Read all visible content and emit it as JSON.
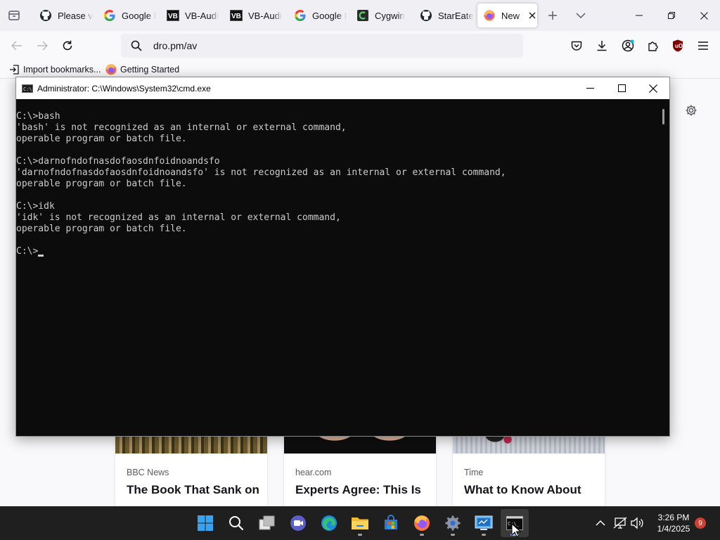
{
  "browser": {
    "tabs": [
      {
        "label": "Please v",
        "icon": "github-icon"
      },
      {
        "label": "Google I",
        "icon": "google-icon"
      },
      {
        "label": "VB-Audi",
        "icon": "vb-audio-icon"
      },
      {
        "label": "VB-Audi",
        "icon": "vb-audio-icon"
      },
      {
        "label": "Google I",
        "icon": "google-icon"
      },
      {
        "label": "Cygwin",
        "icon": "cygwin-icon"
      },
      {
        "label": "StarEate",
        "icon": "github-icon"
      },
      {
        "label": "New T",
        "icon": "firefox-icon",
        "active": true
      }
    ],
    "url": "dro.pm/av",
    "bookmarks": [
      {
        "label": "Import bookmarks...",
        "icon": "import-icon"
      },
      {
        "label": "Getting Started",
        "icon": "firefox-icon"
      }
    ],
    "cards": [
      {
        "source": "BBC News",
        "headline": "The Book That Sank on"
      },
      {
        "source": "hear.com",
        "headline": "Experts Agree: This Is"
      },
      {
        "source": "Time",
        "headline": "What to Know About"
      }
    ]
  },
  "cmd": {
    "title": "Administrator: C:\\Windows\\System32\\cmd.exe",
    "lines": [
      "C:\\>bash",
      "'bash' is not recognized as an internal or external command,",
      "operable program or batch file.",
      "",
      "C:\\>darnofndofnasdofaosdnfoidnoandsfo",
      "'darnofndofnasdofaosdnfoidnoandsfo' is not recognized as an internal or external command,",
      "operable program or batch file.",
      "",
      "C:\\>idk",
      "'idk' is not recognized as an internal or external command,",
      "operable program or batch file.",
      "",
      "C:\\>"
    ]
  },
  "taskbar": {
    "apps": [
      "start-icon",
      "search-icon",
      "task-view-icon",
      "teams-icon",
      "edge-icon",
      "file-explorer-icon",
      "store-icon",
      "firefox-icon",
      "settings-icon",
      "control-panel-icon",
      "cmd-icon"
    ],
    "time": "3:26 PM",
    "date": "1/4/2025",
    "notifications": "9"
  }
}
